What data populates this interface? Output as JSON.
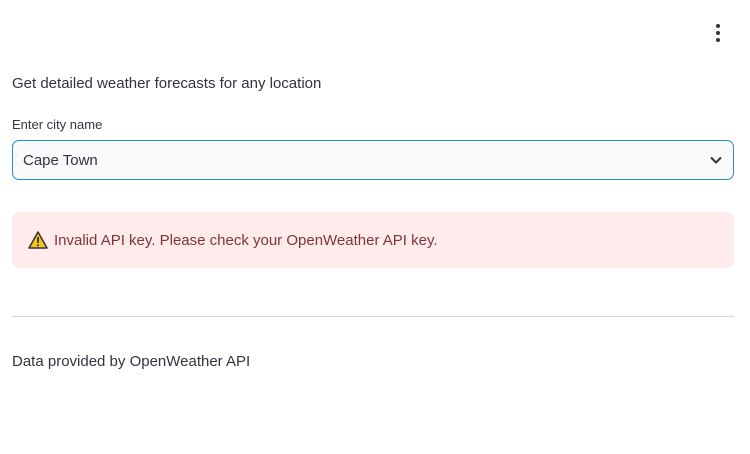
{
  "header": {
    "menu_icon": "vertical-ellipsis-icon"
  },
  "main": {
    "subtitle": "Get detailed weather forecasts for any location",
    "city_select": {
      "label": "Enter city name",
      "value": "Cape Town",
      "icon": "chevron-down-icon"
    },
    "alert": {
      "icon": "warning-icon",
      "message": "Invalid API key. Please check your OpenWeather API key."
    },
    "footer": "Data provided by OpenWeather API"
  },
  "colors": {
    "accent_border": "#2f86c9",
    "alert_background": "#ffebeb",
    "alert_text": "#7d353b",
    "warning_yellow": "#f5c518",
    "text": "#31333f"
  }
}
